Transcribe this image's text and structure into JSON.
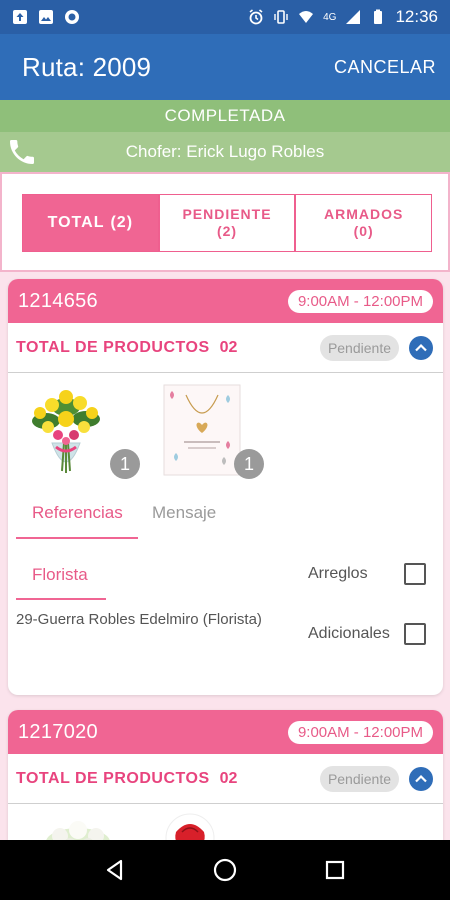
{
  "status_bar": {
    "time": "12:36",
    "network": "4G"
  },
  "app_bar": {
    "title": "Ruta: 2009",
    "cancel_label": "CANCELAR"
  },
  "route_status": "COMPLETADA",
  "driver": "Chofer: Erick Lugo Robles",
  "tabs": [
    {
      "label": "TOTAL",
      "count": "(2)"
    },
    {
      "label": "PENDIENTE",
      "count": "(2)"
    },
    {
      "label": "ARMADOS",
      "count": "(0)"
    }
  ],
  "orders": [
    {
      "order_id": "1214656",
      "time_window": "9:00AM - 12:00PM",
      "products_label": "TOTAL DE PRODUCTOS",
      "products_count": "02",
      "status": "Pendiente",
      "products": [
        {
          "name": "yellow-flower-bouquet",
          "qty": "1"
        },
        {
          "name": "heart-necklace-card",
          "qty": "1"
        }
      ],
      "subtabs": {
        "references": "Referencias",
        "message": "Mensaje"
      },
      "florista_label": "Florista",
      "florist_name": "29-Guerra Robles Edelmiro (Florista)",
      "checkbox_arreglos": "Arreglos",
      "checkbox_adicionales": "Adicionales"
    },
    {
      "order_id": "1217020",
      "time_window": "9:00AM - 12:00PM",
      "products_label": "TOTAL DE PRODUCTOS",
      "products_count": "02",
      "status": "Pendiente"
    }
  ],
  "colors": {
    "primary": "#2f6db8",
    "accent": "#f06593",
    "status_green": "#8fbf7a"
  }
}
